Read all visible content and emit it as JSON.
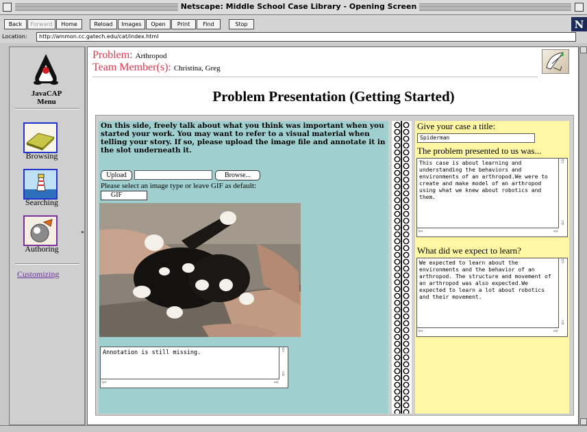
{
  "window": {
    "title": "Netscape: Middle School Case Library - Opening Screen"
  },
  "toolbar": {
    "buttons": [
      "Back",
      "Forward",
      "Home",
      "Reload",
      "Images",
      "Open",
      "Print",
      "Find",
      "Stop"
    ],
    "logo": "N"
  },
  "location": {
    "label": "Location:",
    "url": "http://ammon.cc.gatech.edu/cat/index.html"
  },
  "sidebar": {
    "menu_title_1": "JavaCAP",
    "menu_title_2": "Menu",
    "items": [
      {
        "label": "Browsing",
        "icon": "book-icon"
      },
      {
        "label": "Searching",
        "icon": "lighthouse-icon"
      },
      {
        "label": "Authoring",
        "icon": "authoring-icon"
      }
    ],
    "link": "Customizing"
  },
  "header": {
    "problem_label": "Problem:",
    "problem_value": "Arthropod",
    "team_label": "Team Member(s):",
    "team_value": "Christina, Greg"
  },
  "heading": "Problem Presentation (Getting Started)",
  "left_panel": {
    "intro": "On this side, freely talk about what you think was important when you started your work. You may want to refer to a visual material when telling your story. If so, please upload the image file and annotate it in the slot underneath it.",
    "upload_button": "Upload",
    "browse_button": "Browse...",
    "file_value": "",
    "select_hint": "Please select an image type or leave GIF as default:",
    "image_type": "GIF",
    "annotation": "Annotation is still missing."
  },
  "right_panel": {
    "title_label": "Give your case a title:",
    "title_value": "Spiderman",
    "problem_label": "The problem presented to us was...",
    "problem_text": "This case is about learning and understanding the behaviors and environments of an arthropod.We were to create and make model of an arthropod using what we knew about robotics and them.",
    "expect_label": "What did we expect to learn?",
    "expect_text": "We expected to learn about the environments and the behavior of an arthropod. The structure and movement of an arthropod was also expected.We expected to learn a lot about robotics and their movement."
  },
  "colors": {
    "label_red": "#e0344a",
    "teal_panel": "#9fcfcf",
    "yellow_panel": "#fff7a4",
    "link_purple": "#6b2fa0"
  }
}
